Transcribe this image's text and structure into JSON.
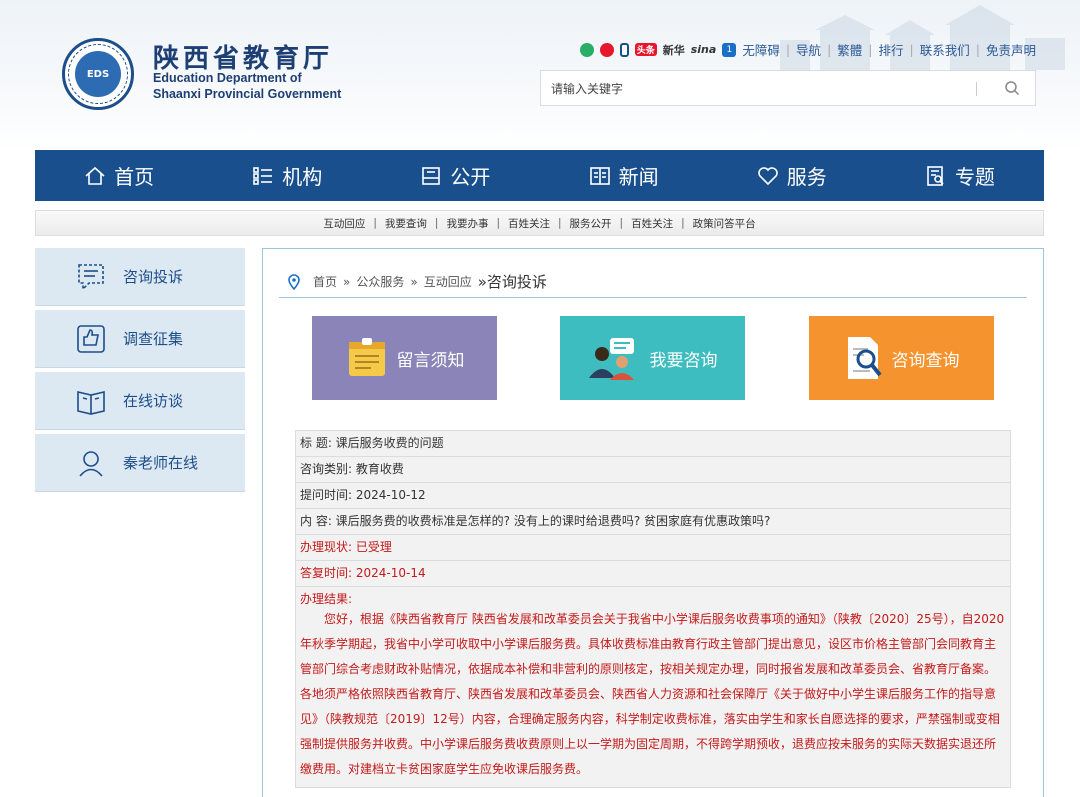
{
  "header": {
    "site_name": "陕西省教育厅",
    "site_name_en1": "Education Department of",
    "site_name_en2": "Shaanxi Provincial Government",
    "logo_text": "EDS",
    "social_labels": [
      "头条",
      "新华",
      "sina"
    ],
    "top_links": [
      "无障碍",
      "导航",
      "繁體",
      "排行",
      "联系我们",
      "免责声明"
    ],
    "search_placeholder": "请输入关键字"
  },
  "nav": {
    "items": [
      "首页",
      "机构",
      "公开",
      "新闻",
      "服务",
      "专题"
    ]
  },
  "subnav": {
    "items": [
      "互动回应",
      "我要查询",
      "我要办事",
      "百姓关注",
      "服务公开",
      "百姓关注",
      "政策问答平台"
    ]
  },
  "sidebar": {
    "items": [
      "咨询投诉",
      "调查征集",
      "在线访谈",
      "秦老师在线"
    ]
  },
  "breadcrumb": {
    "home": "首页",
    "sep": "»",
    "level1": "公众服务",
    "level2": "互动回应",
    "current": "»咨询投诉"
  },
  "tiles": [
    "留言须知",
    "我要咨询",
    "咨询查询"
  ],
  "detail": {
    "title": "标 题:  课后服务收费的问题",
    "category": "咨询类别:  教育收费",
    "ask_time": "提问时间:  2024-10-12",
    "content": "内 容:  课后服务费的收费标准是怎样的? 没有上的课时给退费吗? 贫困家庭有优惠政策吗?",
    "status": "办理现状:  已受理",
    "reply_time": "答复时间:  2024-10-14",
    "result_label": "办理结果:",
    "result_text": "您好，根据《陕西省教育厅 陕西省发展和改革委员会关于我省中小学课后服务收费事项的通知》（陕教〔2020〕25号），自2020年秋季学期起，我省中小学可收取中小学课后服务费。具体收费标准由教育行政主管部门提出意见，设区市价格主管部门会同教育主管部门综合考虑财政补贴情况，依据成本补偿和非营利的原则核定，按相关规定办理，同时报省发展和改革委员会、省教育厅备案。各地须严格依照陕西省教育厅、陕西省发展和改革委员会、陕西省人力资源和社会保障厅《关于做好中小学生课后服务工作的指导意见》（陕教规范〔2019〕12号）内容，合理确定服务内容，科学制定收费标准，落实由学生和家长自愿选择的要求，严禁强制或变相强制提供服务并收费。中小学课后服务费收费原则上以一学期为固定周期，不得跨学期预收，退费应按未服务的实际天数据实退还所缴费用。对建档立卡贫困家庭学生应免收课后服务费。"
  },
  "colors": {
    "nav_bg": "#1a4f8d",
    "tile1": "#8b84b8",
    "tile2": "#3ebdc0",
    "tile3": "#f5932e",
    "alert_red": "#c41a1a"
  }
}
